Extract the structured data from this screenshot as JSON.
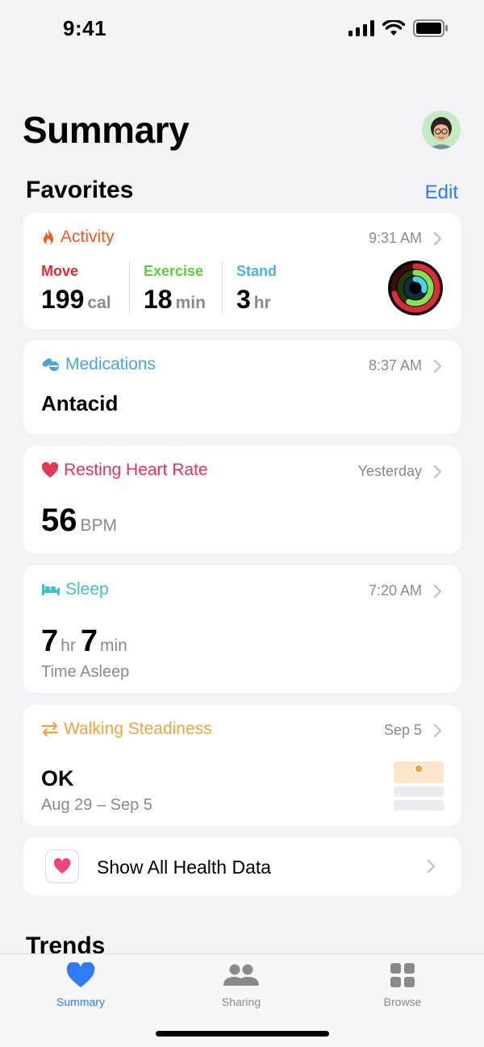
{
  "status_bar": {
    "time": "9:41"
  },
  "header": {
    "title": "Summary"
  },
  "favorites": {
    "title": "Favorites",
    "edit_label": "Edit"
  },
  "colors": {
    "activity": "#f05a23",
    "move": "#e02a3b",
    "exercise": "#5ece3a",
    "stand": "#4bb3d9",
    "medications": "#4aa6d8",
    "heart": "#e63555",
    "sleep": "#3fc1c9",
    "steadiness": "#f0a53c",
    "accent": "#2f7cf6"
  },
  "activity": {
    "title": "Activity",
    "time": "9:31 AM",
    "move": {
      "label": "Move",
      "value": "199",
      "unit": "cal"
    },
    "exercise": {
      "label": "Exercise",
      "value": "18",
      "unit": "min"
    },
    "stand": {
      "label": "Stand",
      "value": "3",
      "unit": "hr"
    }
  },
  "medications": {
    "title": "Medications",
    "time": "8:37 AM",
    "value": "Antacid"
  },
  "heart_rate": {
    "title": "Resting Heart Rate",
    "time": "Yesterday",
    "value": "56",
    "unit": "BPM"
  },
  "sleep": {
    "title": "Sleep",
    "time": "7:20 AM",
    "hours": "7",
    "hours_unit": "hr",
    "minutes": "7",
    "minutes_unit": "min",
    "caption": "Time Asleep"
  },
  "steadiness": {
    "title": "Walking Steadiness",
    "time": "Sep 5",
    "value": "OK",
    "range": "Aug 29 – Sep 5"
  },
  "show_all": {
    "label": "Show All Health Data"
  },
  "trends": {
    "title": "Trends"
  },
  "tabs": [
    {
      "label": "Summary",
      "icon": "heart-icon",
      "active": true
    },
    {
      "label": "Sharing",
      "icon": "people-icon",
      "active": false
    },
    {
      "label": "Browse",
      "icon": "grid-icon",
      "active": false
    }
  ]
}
